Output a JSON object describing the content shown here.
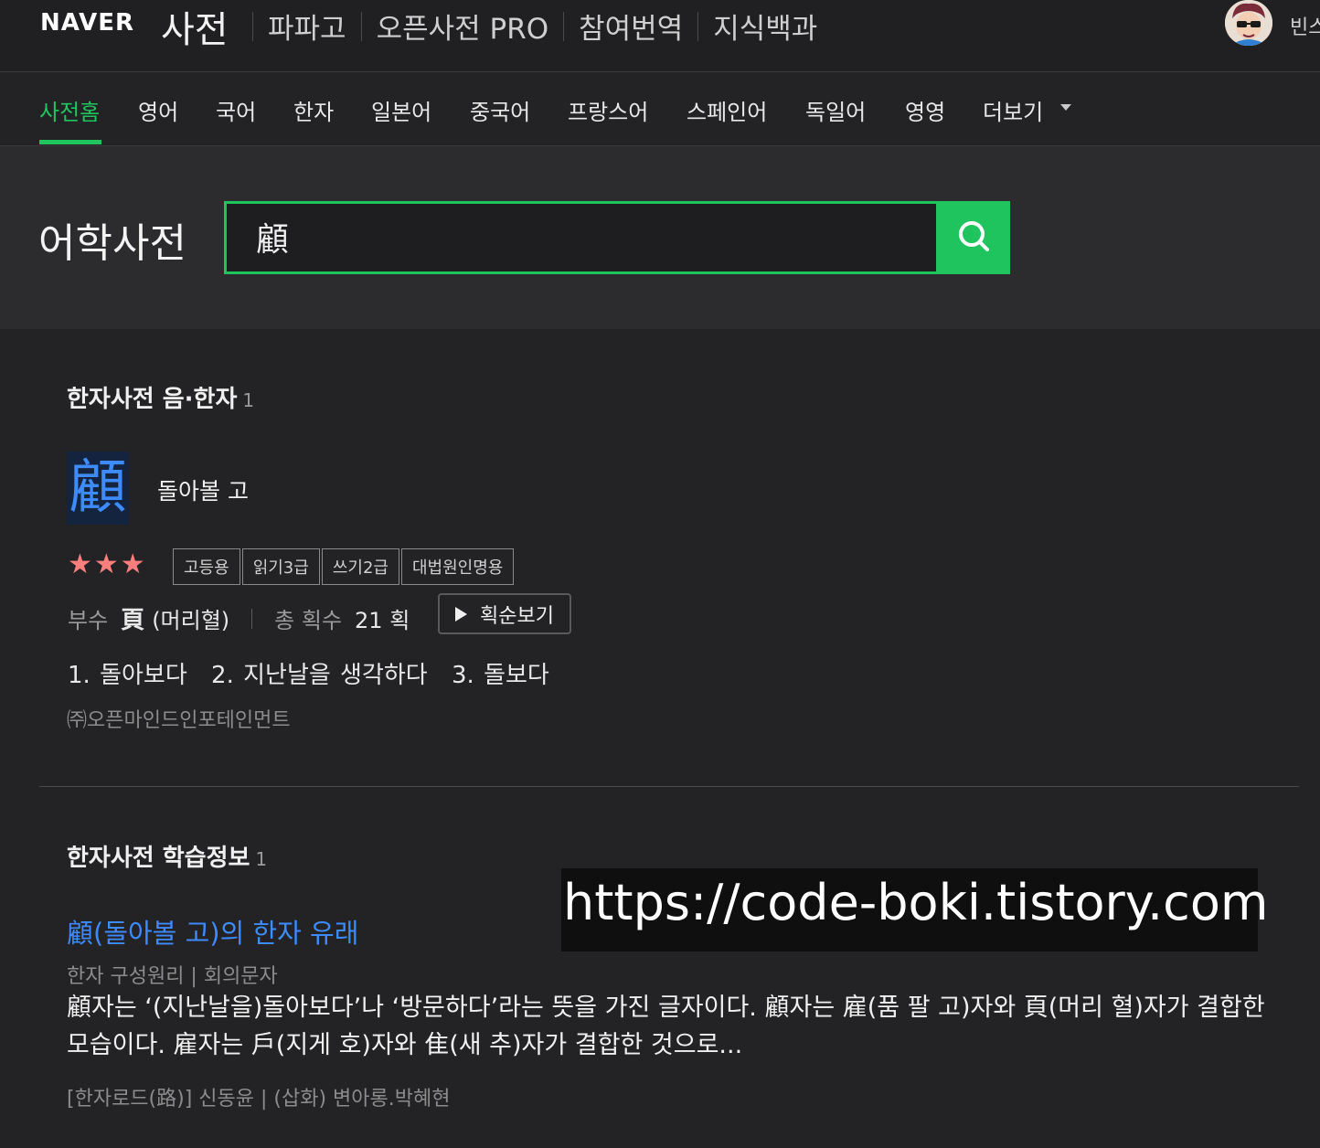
{
  "header": {
    "naver_logo": "NAVER",
    "dict_logo": "사전",
    "services": [
      "파파고",
      "오픈사전 PRO",
      "참여번역",
      "지식백과"
    ],
    "username": "빈스"
  },
  "nav": {
    "tabs": [
      "사전홈",
      "영어",
      "국어",
      "한자",
      "일본어",
      "중국어",
      "프랑스어",
      "스페인어",
      "독일어",
      "영영"
    ],
    "more": "더보기",
    "active": "사전홈"
  },
  "search": {
    "title": "어학사전",
    "query": "顧",
    "button_icon": "search-icon"
  },
  "hanja_section": {
    "title": "한자사전 음·한자",
    "count": "1",
    "character": "顧",
    "meaning": "돌아볼 고",
    "stars": "★★★",
    "tags": [
      "고등용",
      "읽기3급",
      "쓰기2급",
      "대법원인명용"
    ],
    "radical_label": "부수",
    "radical_char": "頁",
    "radical_name": "(머리혈)",
    "strokes_label": "총 획수",
    "strokes_value": "21 획",
    "stroke_button": "획순보기",
    "meanings": [
      "1. 돌아보다",
      "2. 지난날을 생각하다",
      "3. 돌보다"
    ],
    "source": "㈜오픈마인드인포테인먼트"
  },
  "study_section": {
    "title": "한자사전 학습정보",
    "count": "1",
    "link": "顧(돌아볼 고)의 한자 유래",
    "meta": "한자 구성원리 | 회의문자",
    "body": "顧자는 ‘(지난날을)돌아보다’나 ‘방문하다’라는 뜻을 가진 글자이다. 顧자는 雇(품 팔 고)자와 頁(머리 혈)자가 결합한 모습이다. 雇자는 戶(지게 호)자와 隹(새 추)자가 결합한 것으로...",
    "source": "[한자로드(路)] 신동윤 | (삽화) 변아롱.박혜현"
  },
  "watermark": "https://code-boki.tistory.com",
  "colors": {
    "accent": "#1fc45e",
    "link": "#3d8bff",
    "star": "#ff7e7e",
    "background": "#232325"
  }
}
